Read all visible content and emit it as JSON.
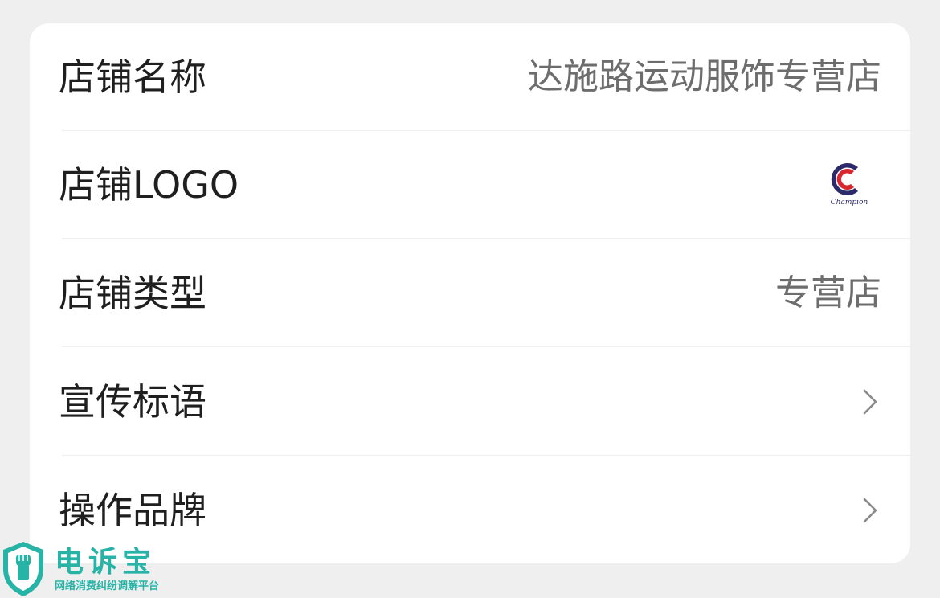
{
  "rows": [
    {
      "label": "店铺名称",
      "value": "达施路运动服饰专营店"
    },
    {
      "label": "店铺LOGO",
      "logo_text": "Champion"
    },
    {
      "label": "店铺类型",
      "value": "专营店"
    },
    {
      "label": "宣传标语"
    },
    {
      "label": "操作品牌"
    }
  ],
  "watermark": {
    "title": "电诉宝",
    "subtitle": "网络消费纠纷调解平台"
  },
  "colors": {
    "background": "#efefef",
    "card": "#ffffff",
    "label": "#1f1f1f",
    "value": "#6d6d6d",
    "watermark": "#27b3a6",
    "logo_red": "#d8262f",
    "logo_navy": "#2c2a6b"
  }
}
